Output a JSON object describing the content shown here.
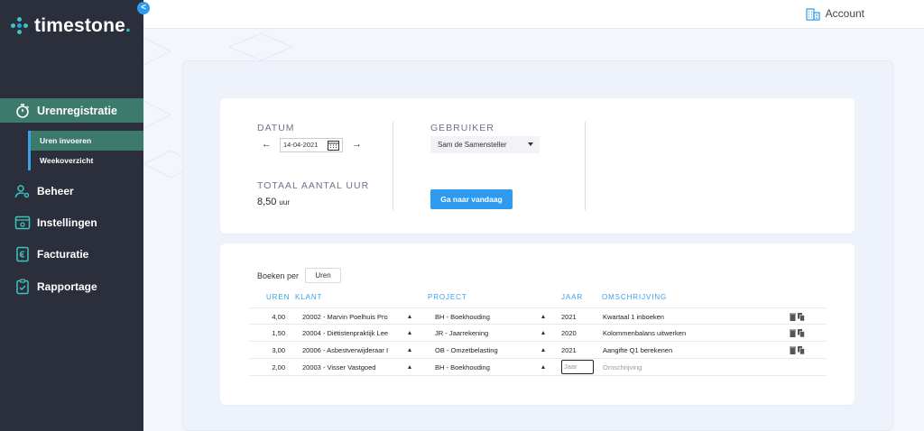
{
  "app": {
    "name": "timestone",
    "name_suffix": ".",
    "collapse_glyph": "<"
  },
  "header": {
    "account_label": "Account",
    "account_icon": "building-icon"
  },
  "sidebar": {
    "items": [
      {
        "label": "Urenregistratie",
        "icon": "stopwatch-icon",
        "active": true
      },
      {
        "label": "Beheer",
        "icon": "user-cog-icon"
      },
      {
        "label": "Instellingen",
        "icon": "settings-panel-icon"
      },
      {
        "label": "Facturatie",
        "icon": "euro-document-icon"
      },
      {
        "label": "Rapportage",
        "icon": "clipboard-check-icon"
      }
    ],
    "subitems": [
      {
        "label": "Uren invoeren",
        "active": true
      },
      {
        "label": "Weekoverzicht"
      }
    ]
  },
  "summary": {
    "datum_label": "DATUM",
    "date_value": "14-04-2021",
    "prev_glyph": "←",
    "next_glyph": "→",
    "totaal_label": "TOTAAL AANTAL UUR",
    "total_value": "8,50",
    "total_unit": "uur",
    "gebruiker_label": "GEBRUIKER",
    "user_value": "Sam de Samensteller",
    "today_button": "Ga naar vandaag"
  },
  "bookings": {
    "boeken_per_label": "Boeken per",
    "boeken_per_value": "Uren",
    "columns": {
      "uren": "UREN",
      "klant": "KLANT",
      "project": "PROJECT",
      "jaar": "JAAR",
      "omschrijving": "OMSCHRIJVING"
    },
    "rows": [
      {
        "uren": "4,00",
        "klant": "20002 - Marvin Poelhuis Pro",
        "project": "BH - Boekhouding",
        "jaar": "2021",
        "omschrijving": "Kwartaal 1 inboeken"
      },
      {
        "uren": "1,50",
        "klant": "20004 - Diëtistenpraktijk Lee",
        "project": "JR - Jaarrekening",
        "jaar": "2020",
        "omschrijving": "Kolommenbalans uitwerken"
      },
      {
        "uren": "3,00",
        "klant": "20006 - Asbestverwijderaar I",
        "project": "OB - Omzetbelasting",
        "jaar": "2021",
        "omschrijving": "Aangifte Q1 berekenen"
      }
    ],
    "new_row": {
      "uren": "2,00",
      "klant": "20003 - Visser Vastgoed",
      "project": "BH - Boekhouding",
      "jaar_placeholder": "Jaar",
      "omschrijving_placeholder": "Omschrijving"
    }
  },
  "colors": {
    "sidebar_bg": "#2b2f3b",
    "active_green": "#3c7a6c",
    "accent_blue": "#2e9bf0",
    "teal": "#3cc4c0"
  }
}
